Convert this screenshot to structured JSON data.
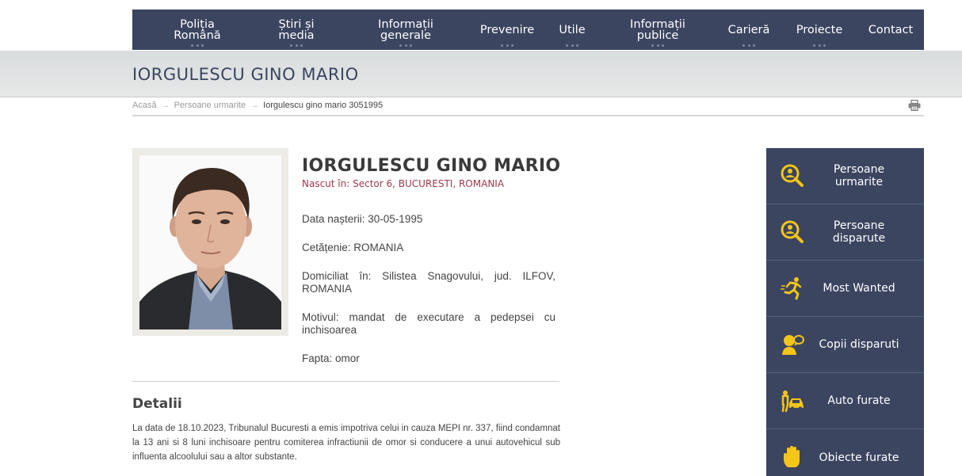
{
  "nav": {
    "items": [
      {
        "label": "Poliția Română",
        "line1": "Poliția",
        "line2": "Română",
        "has_dots": true
      },
      {
        "label": "Știri și media",
        "line1": "Știri și",
        "line2": "media",
        "has_dots": true
      },
      {
        "label": "Informații generale",
        "line1": "Informații",
        "line2": "generale",
        "has_dots": true
      },
      {
        "label": "Prevenire",
        "line1": "Prevenire",
        "line2": "",
        "has_dots": true
      },
      {
        "label": "Utile",
        "line1": "Utile",
        "line2": "",
        "has_dots": true
      },
      {
        "label": "Informații publice",
        "line1": "Informații",
        "line2": "publice",
        "has_dots": true
      },
      {
        "label": "Carieră",
        "line1": "Carieră",
        "line2": "",
        "has_dots": true
      },
      {
        "label": "Proiecte",
        "line1": "Proiecte",
        "line2": "",
        "has_dots": true
      },
      {
        "label": "Contact",
        "line1": "Contact",
        "line2": "",
        "has_dots": false
      }
    ]
  },
  "page": {
    "title": "IORGULESCU GINO MARIO"
  },
  "breadcrumb": {
    "home": "Acasă",
    "section": "Persoane urmarite",
    "current": "Iorgulescu gino mario 3051995",
    "separator": "→"
  },
  "person": {
    "name": "IORGULESCU GINO MARIO",
    "born": "Nascut în: Sector 6, BUCURESTI, ROMANIA",
    "birth_date": "Data nașterii: 30-05-1995",
    "citizenship": "Cetățenie: ROMANIA",
    "residence": "Domiciliat în: Silistea Snagovului, jud. ILFOV, ROMANIA",
    "reason": "Motivul: mandat de executare a pedepsei cu inchisoarea",
    "deed": "Fapta: omor"
  },
  "details": {
    "title": "Detalii",
    "text": "La data de 18.10.2023, Tribunalul Bucuresti a emis impotriva celui in cauza MEPI nr. 337, fiind condamnat la 13 ani si 8 luni inchisoare pentru comiterea infractiunii de omor si conducere a unui autovehicul sub influenta alcoolului sau a altor substante."
  },
  "sidebar": {
    "items": [
      {
        "label": "Persoane urmarite",
        "line1": "Persoane",
        "line2": "urmarite",
        "icon": "search-person-icon"
      },
      {
        "label": "Persoane disparute",
        "line1": "Persoane",
        "line2": "disparute",
        "icon": "search-person-icon"
      },
      {
        "label": "Most Wanted",
        "line1": "Most Wanted",
        "line2": "",
        "icon": "running-man-icon"
      },
      {
        "label": "Copii disparuti",
        "line1": "Copii disparuti",
        "line2": "",
        "icon": "child-icon"
      },
      {
        "label": "Auto furate",
        "line1": "Auto furate",
        "line2": "",
        "icon": "car-thief-icon"
      },
      {
        "label": "Obiecte furate",
        "line1": "Obiecte furate",
        "line2": "",
        "icon": "hand-icon"
      }
    ]
  },
  "colors": {
    "nav_bg": "#3b4560",
    "accent_yellow": "#f5c518",
    "born_red": "#a0384a"
  }
}
